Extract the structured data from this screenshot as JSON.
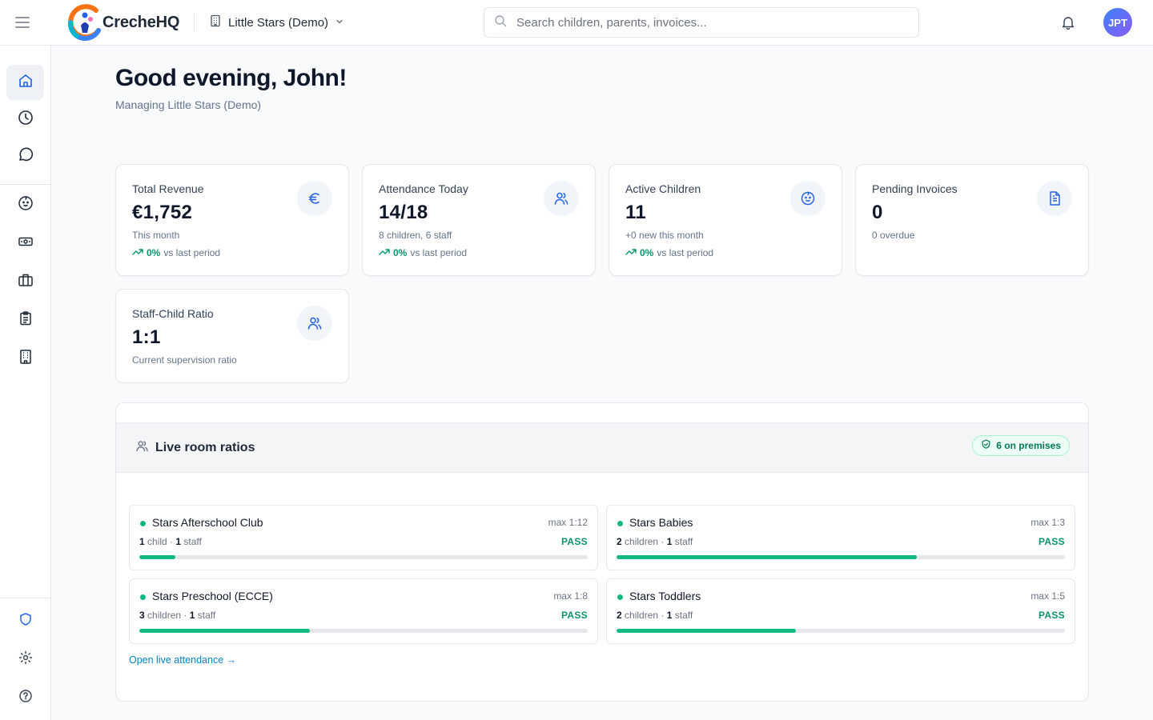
{
  "app": {
    "logo_text": "CrecheHQ",
    "org_name": "Little Stars (Demo)",
    "search_placeholder": "Search children, parents, invoices...",
    "user_initials": "JPT"
  },
  "sidebar": {
    "items": [
      {
        "icon": "home-icon",
        "active": true
      },
      {
        "icon": "clock-icon"
      },
      {
        "icon": "message-icon"
      },
      {
        "icon": "baby-icon"
      },
      {
        "icon": "banknote-icon"
      },
      {
        "icon": "briefcase-icon"
      },
      {
        "icon": "clipboard-icon"
      },
      {
        "icon": "building-icon"
      }
    ],
    "bottom_items": [
      {
        "icon": "shield-icon"
      },
      {
        "icon": "settings-icon"
      },
      {
        "icon": "help-icon"
      }
    ]
  },
  "header": {
    "greeting": "Good evening, John!",
    "subtitle": "Managing Little Stars (Demo)"
  },
  "stats": [
    {
      "title": "Total Revenue",
      "value": "€1,752",
      "sub": "This month",
      "trend_pct": "0%",
      "trend_label": "vs last period",
      "icon": "euro-icon"
    },
    {
      "title": "Attendance Today",
      "value": "14/18",
      "sub": "8 children, 6 staff",
      "trend_pct": "0%",
      "trend_label": "vs last period",
      "icon": "users-icon"
    },
    {
      "title": "Active Children",
      "value": "11",
      "sub": "+0 new this month",
      "trend_pct": "0%",
      "trend_label": "vs last period",
      "icon": "baby-icon"
    },
    {
      "title": "Pending Invoices",
      "value": "0",
      "sub": "0 overdue",
      "icon": "file-icon"
    },
    {
      "title": "Staff-Child Ratio",
      "value": "1:1",
      "sub": "Current supervision ratio",
      "icon": "users-icon"
    }
  ],
  "ratios": {
    "title": "Live room ratios",
    "premises_badge": "6 on premises",
    "link": "Open live attendance →",
    "rooms": [
      {
        "name": "Stars Afterschool Club",
        "max": "max 1:12",
        "children_count": "1",
        "children_label": "child",
        "staff_count": "1",
        "staff_label": "staff",
        "status": "PASS",
        "fill": 0.08
      },
      {
        "name": "Stars Babies",
        "max": "max 1:3",
        "children_count": "2",
        "children_label": "children",
        "staff_count": "1",
        "staff_label": "staff",
        "status": "PASS",
        "fill": 0.67
      },
      {
        "name": "Stars Preschool (ECCE)",
        "max": "max 1:8",
        "children_count": "3",
        "children_label": "children",
        "staff_count": "1",
        "staff_label": "staff",
        "status": "PASS",
        "fill": 0.38
      },
      {
        "name": "Stars Toddlers",
        "max": "max 1:5",
        "children_count": "2",
        "children_label": "children",
        "staff_count": "1",
        "staff_label": "staff",
        "status": "PASS",
        "fill": 0.4
      }
    ]
  },
  "colors": {
    "accent": "#0284c7",
    "success": "#10b981",
    "avatar_gradient": [
      "#3b82f6",
      "#8b5cf6"
    ]
  }
}
